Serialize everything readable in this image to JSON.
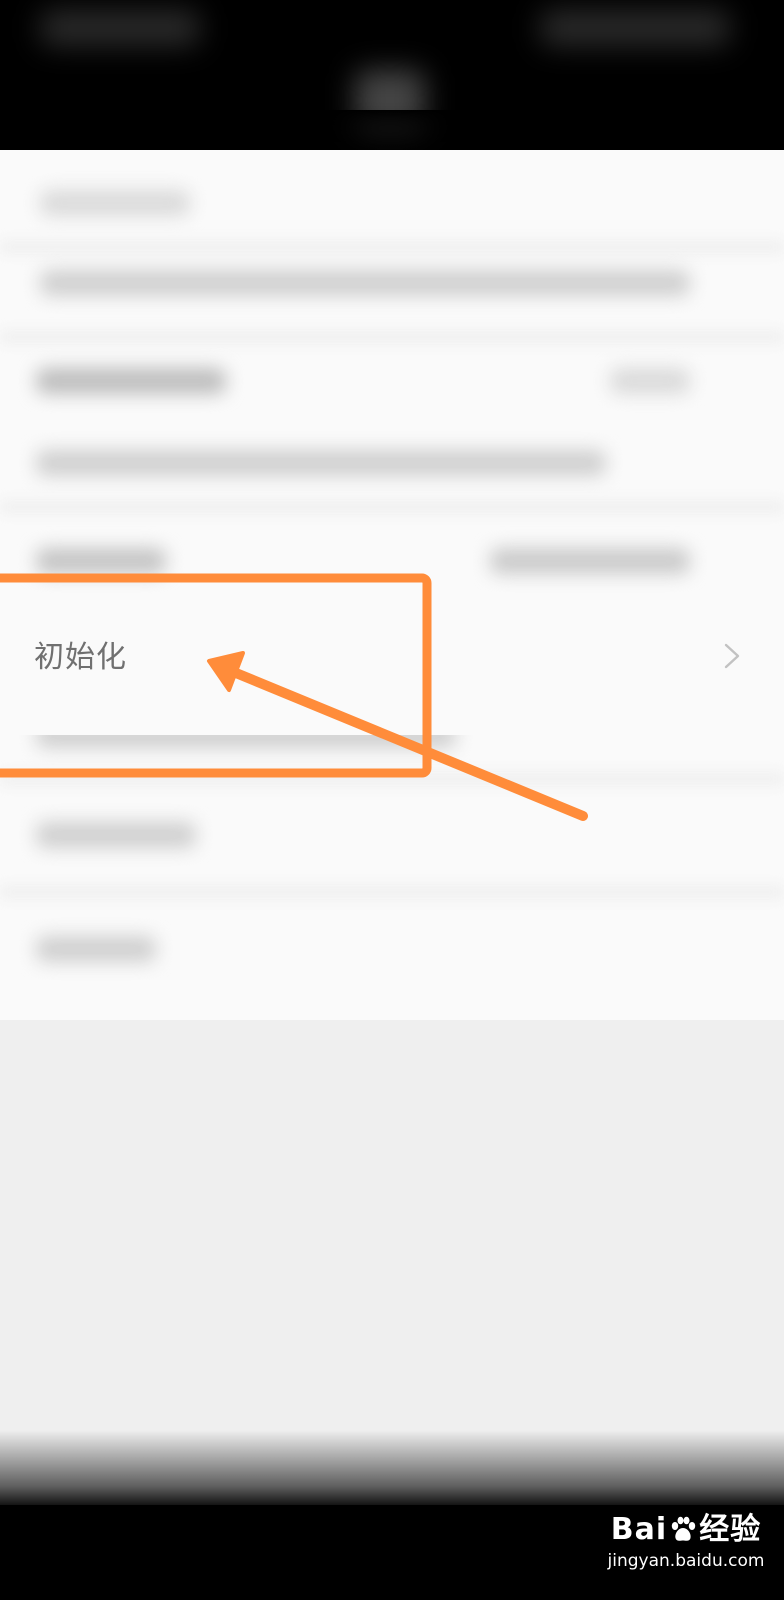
{
  "settings": {
    "highlighted_row": {
      "label": "初始化",
      "chevron_icon": "chevron-right-icon"
    }
  },
  "annotation": {
    "highlight_color": "#FF8C3A",
    "arrow_color": "#FF8C3A"
  },
  "watermark": {
    "logo_text_left": "Bai",
    "logo_text_right": "经验",
    "site": "jingyan.baidu.com"
  }
}
